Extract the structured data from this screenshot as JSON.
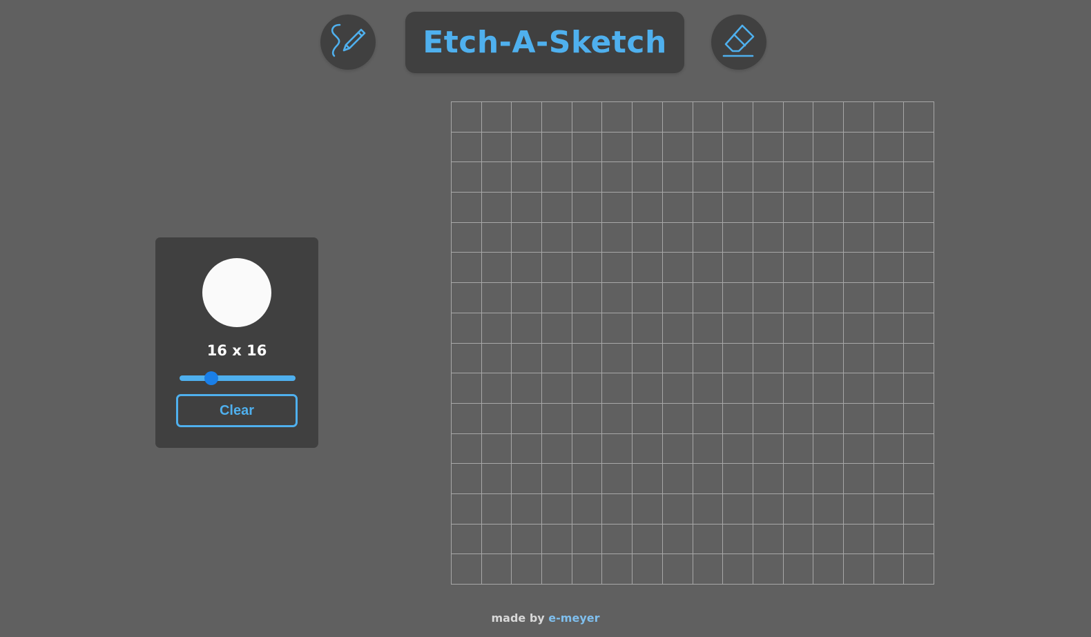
{
  "header": {
    "title": "Etch-A-Sketch",
    "pen_icon": "pen-draw-icon",
    "eraser_icon": "eraser-icon"
  },
  "controls": {
    "selected_color": "#fafafa",
    "size_label": "16 x 16",
    "grid_size": 16,
    "slider_min": 1,
    "slider_max": 100,
    "slider_value": 16,
    "clear_label": "Clear"
  },
  "footer": {
    "prefix": "made by",
    "author": "e-meyer"
  },
  "colors": {
    "accent": "#4fb0ee",
    "background": "#606060",
    "panel": "#404040",
    "grid_line": "#a8a8a8",
    "slider_thumb": "#1a7fe8"
  }
}
